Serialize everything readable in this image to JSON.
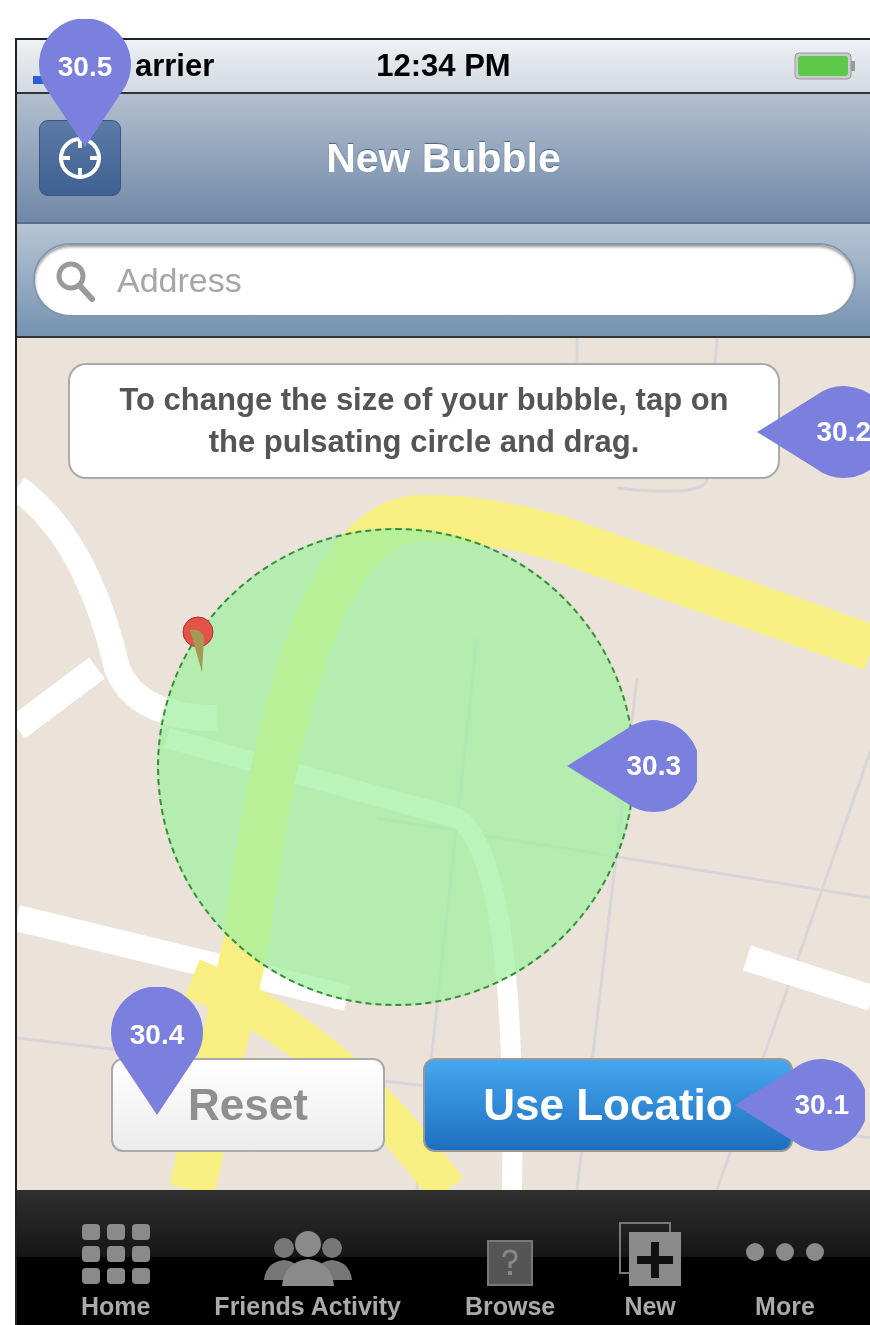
{
  "status_bar": {
    "carrier": "arrier",
    "time": "12:34 PM"
  },
  "nav_bar": {
    "title": "New Bubble"
  },
  "search": {
    "placeholder": "Address"
  },
  "map": {
    "hint": "To change the size of your bubble, tap on the pulsating circle and drag."
  },
  "buttons": [
    {
      "label": "Reset",
      "kind": "secondary"
    },
    {
      "label": "Use Locatio",
      "kind": "primary"
    }
  ],
  "tab_bar": [
    {
      "label": "Home",
      "kind": "home",
      "selected": false
    },
    {
      "label": "Friends Activity",
      "kind": "friends",
      "selected": false
    },
    {
      "label": "Browse",
      "kind": "browse",
      "selected": false
    },
    {
      "label": "New",
      "kind": "new",
      "selected": false
    },
    {
      "label": "More",
      "kind": "more",
      "selected": false
    }
  ],
  "annotations": [
    {
      "label": "30.5"
    },
    {
      "label": "30.2"
    },
    {
      "label": "30.3"
    },
    {
      "label": "30.4"
    },
    {
      "label": "30.1"
    }
  ]
}
